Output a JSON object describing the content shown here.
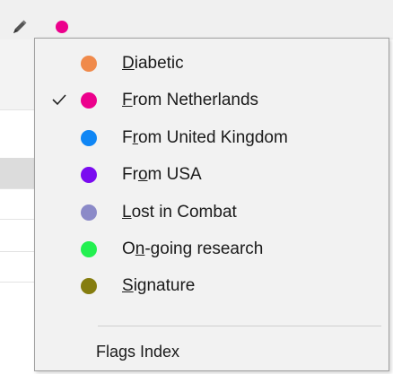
{
  "toolbar": {
    "edit_icon": "pencil-icon",
    "flag_color": "#ec008c"
  },
  "menu": {
    "items": [
      {
        "pre": "",
        "mn": "D",
        "post": "iabetic",
        "color": "#f08a4b",
        "checked": false
      },
      {
        "pre": "",
        "mn": "F",
        "post": "rom Netherlands",
        "color": "#ec008c",
        "checked": true
      },
      {
        "pre": "F",
        "mn": "r",
        "post": "om United Kingdom",
        "color": "#0f86f5",
        "checked": false
      },
      {
        "pre": "Fr",
        "mn": "o",
        "post": "m USA",
        "color": "#7a0bf0",
        "checked": false
      },
      {
        "pre": "",
        "mn": "L",
        "post": "ost in Combat",
        "color": "#8b8ac8",
        "checked": false
      },
      {
        "pre": "O",
        "mn": "n",
        "post": "-going research",
        "color": "#23f050",
        "checked": false
      },
      {
        "pre": "",
        "mn": "S",
        "post": "ignature",
        "color": "#857d0f",
        "checked": false
      }
    ],
    "footer_label": "Flags Index"
  }
}
